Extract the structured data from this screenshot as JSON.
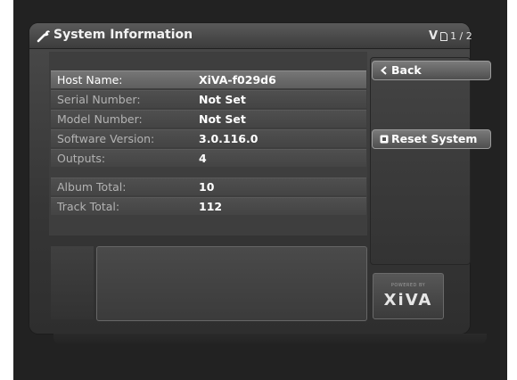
{
  "window": {
    "title": "System Information",
    "title_icon": "wrench-icon",
    "page_indicator": {
      "glyph": "V",
      "icon": "page-icon",
      "text": "1 / 2"
    }
  },
  "info_rows": [
    {
      "label": "Host Name:",
      "value": "XiVA-f029d6",
      "selected": true
    },
    {
      "label": "Serial Number:",
      "value": "Not Set"
    },
    {
      "label": "Model Number:",
      "value": "Not Set"
    },
    {
      "label": "Software Version:",
      "value": "3.0.116.0"
    },
    {
      "label": "Outputs:",
      "value": "4"
    },
    {
      "label": "Album Total:",
      "value": "10"
    },
    {
      "label": "Track Total:",
      "value": "112"
    }
  ],
  "side_menu": {
    "back_label": "Back",
    "back_icon": "chevron-left-icon",
    "reset_label": "Reset System",
    "reset_icon": "square-bullet-icon"
  },
  "logo": {
    "powered_text": "POWERED BY",
    "brand_text": "XiVA"
  }
}
